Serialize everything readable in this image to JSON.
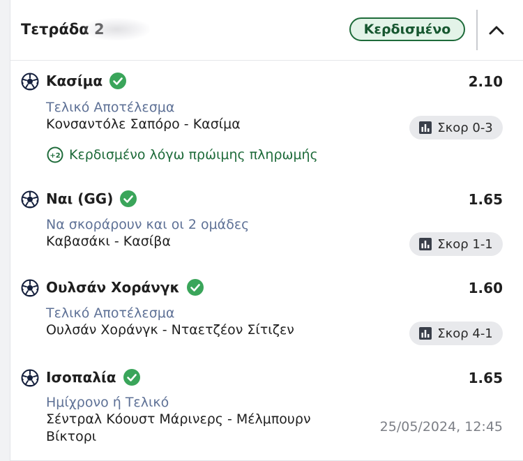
{
  "header": {
    "title": "Τετράδα 2",
    "status_badge": "Κερδισμένο",
    "collapse_icon": "chevron-up-icon"
  },
  "colors": {
    "win_green": "#1e6b3a",
    "market_blue_gray": "#5e7196",
    "pill_bg": "#e8e9ec"
  },
  "selections": [
    {
      "name": "Κασίμα",
      "odds": "2.10",
      "market": "Τελικό Αποτέλεσμα",
      "event": "Κονσαντόλε Σαπόρο - Κασίμα",
      "score": "Σκορ 0-3",
      "early_payout": "Κερδισμένο λόγω πρώιμης πληρωμής",
      "early_payout_badge": "+2"
    },
    {
      "name": "Ναι (GG)",
      "odds": "1.65",
      "market": "Να σκοράρουν και οι 2 ομάδες",
      "event": "Καβασάκι - Κασίβα",
      "score": "Σκορ 1-1"
    },
    {
      "name": "Ουλσάν Χοράνγκ",
      "odds": "1.60",
      "market": "Τελικό Αποτέλεσμα",
      "event": "Ουλσάν Χοράνγκ - Νταετζέον Σίτιζεν",
      "score": "Σκορ 4-1"
    },
    {
      "name": "Ισοπαλία",
      "odds": "1.65",
      "market": "Ημίχρονο ή Τελικό",
      "event_line1": "Σέντραλ Κόουστ Μάρινερς - Μέλμπουρν",
      "event_line2": "Βίκτορι",
      "datetime": "25/05/2024, 12:45"
    }
  ]
}
